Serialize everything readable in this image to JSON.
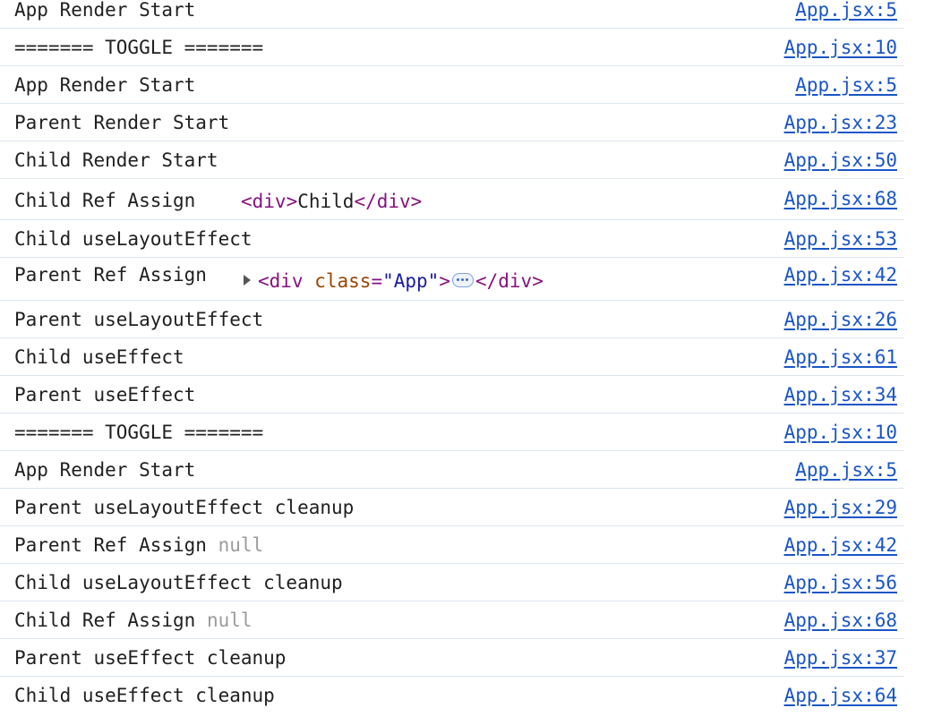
{
  "logs": [
    {
      "text": "App Render Start",
      "source": "App.jsx:5"
    },
    {
      "text": "======= TOGGLE =======",
      "source": "App.jsx:10"
    },
    {
      "text": "App Render Start",
      "source": "App.jsx:5"
    },
    {
      "text": "Parent Render Start",
      "source": "App.jsx:23"
    },
    {
      "text": "Child Render Start",
      "source": "App.jsx:50"
    },
    {
      "text": "Child Ref Assign",
      "source": "App.jsx:68",
      "element": {
        "open_tag": "<div>",
        "content": "Child",
        "close_tag": "</div>"
      }
    },
    {
      "text": "Child useLayoutEffect",
      "source": "App.jsx:53"
    },
    {
      "text": "Parent Ref Assign",
      "source": "App.jsx:42",
      "element": {
        "open_tag_start": "<div",
        "attr_name": "class",
        "attr_eq": "=",
        "attr_value": "\"App\"",
        "open_tag_end": ">",
        "close_tag": "</div>"
      }
    },
    {
      "text": "Parent useLayoutEffect",
      "source": "App.jsx:26"
    },
    {
      "text": "Child useEffect",
      "source": "App.jsx:61"
    },
    {
      "text": "Parent useEffect",
      "source": "App.jsx:34"
    },
    {
      "text": "======= TOGGLE =======",
      "source": "App.jsx:10"
    },
    {
      "text": "App Render Start",
      "source": "App.jsx:5"
    },
    {
      "text": "Parent useLayoutEffect cleanup",
      "source": "App.jsx:29"
    },
    {
      "text": "Parent Ref Assign",
      "source": "App.jsx:42",
      "null": "null"
    },
    {
      "text": "Child useLayoutEffect cleanup",
      "source": "App.jsx:56"
    },
    {
      "text": "Child Ref Assign",
      "source": "App.jsx:68",
      "null": "null"
    },
    {
      "text": "Parent useEffect cleanup",
      "source": "App.jsx:37"
    },
    {
      "text": "Child useEffect cleanup",
      "source": "App.jsx:64"
    }
  ],
  "colors": {
    "link": "#1a55c6",
    "tag": "#881280",
    "attr_name": "#994500",
    "attr_value": "#1a1aa6",
    "null": "#9b9b9b",
    "divider": "#dde6f0"
  },
  "icons": {
    "expand": "disclosure-triangle-right",
    "collapsed_children": "ellipsis-pill"
  }
}
